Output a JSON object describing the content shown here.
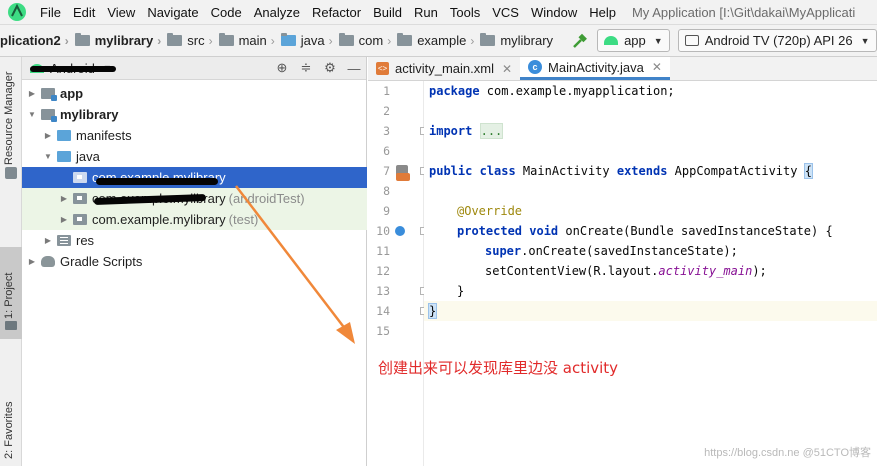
{
  "menubar": {
    "items": [
      "File",
      "Edit",
      "View",
      "Navigate",
      "Code",
      "Analyze",
      "Refactor",
      "Build",
      "Run",
      "Tools",
      "VCS",
      "Window",
      "Help"
    ],
    "window_title": "My Application [I:\\Git\\dakai\\MyApplicati"
  },
  "navbar": {
    "crumbs": [
      "plication2",
      "mylibrary",
      "src",
      "main",
      "java",
      "com",
      "example",
      "mylibrary"
    ],
    "run_config": "app",
    "device": "Android TV (720p) API 26"
  },
  "stripe": {
    "resource_manager": "Resource Manager",
    "project": "1: Project",
    "favorites": "2: Favorites"
  },
  "project_panel": {
    "view_mode": "Android",
    "tree": [
      {
        "label": "app",
        "suffix": ""
      },
      {
        "label": "mylibrary",
        "suffix": ""
      },
      {
        "label": "manifests",
        "suffix": ""
      },
      {
        "label": "java",
        "suffix": ""
      },
      {
        "label": "com.example.mylibrary",
        "suffix": ""
      },
      {
        "label": "com.example.mylibrary",
        "suffix": "(androidTest)"
      },
      {
        "label": "com.example.mylibrary",
        "suffix": "(test)"
      },
      {
        "label": "res",
        "suffix": ""
      },
      {
        "label": "Gradle Scripts",
        "suffix": ""
      }
    ]
  },
  "editor": {
    "tabs": [
      {
        "label": "activity_main.xml",
        "active": false
      },
      {
        "label": "MainActivity.java",
        "active": true
      }
    ],
    "line_numbers": [
      "1",
      "2",
      "3",
      "6",
      "7",
      "8",
      "9",
      "10",
      "11",
      "12",
      "13",
      "14",
      "15"
    ],
    "code": {
      "l1_kw": "package",
      "l1_rest": " com.example.myapplication;",
      "l3_kw": "import",
      "l3_fold": "...",
      "l7_kw1": "public class",
      "l7_name": " MainActivity ",
      "l7_kw2": "extends",
      "l7_rest": " AppCompatActivity ",
      "l7_brace": "{",
      "l9": "@Override",
      "l10_kw": "protected void",
      "l10_rest": " onCreate(Bundle savedInstanceState) {",
      "l11_kw": "super",
      "l11_rest": ".onCreate(savedInstanceState);",
      "l12_pre": "setContentView(R.layout.",
      "l12_it": "activity_main",
      "l12_post": ");",
      "l13": "}",
      "l14": "}"
    }
  },
  "annotation_text": "创建出来可以发现库里边没 activity",
  "watermark": "https://blog.csdn.ne @51CTO博客",
  "colors": {
    "selection": "#2f65ca",
    "keyword": "#0033b3",
    "annotation_arrow": "#f0883a",
    "annotation_text": "#e12a2a"
  }
}
